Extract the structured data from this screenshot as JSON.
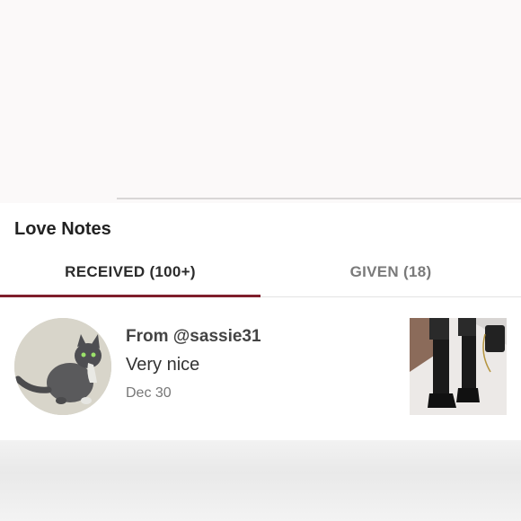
{
  "section": {
    "title": "Love Notes"
  },
  "tabs": [
    {
      "label": "RECEIVED (100+)",
      "active": true
    },
    {
      "label": "GIVEN (18)",
      "active": false
    }
  ],
  "notes": [
    {
      "from": "From @sassie31",
      "message": "Very nice",
      "date": "Dec 30",
      "avatar_icon": "cat-avatar",
      "thumbnail_icon": "boots-thumbnail"
    }
  ],
  "colors": {
    "accent": "#7f1f2c",
    "active_tab_text": "#2b2b2b",
    "inactive_tab_text": "#7a7a7a"
  }
}
